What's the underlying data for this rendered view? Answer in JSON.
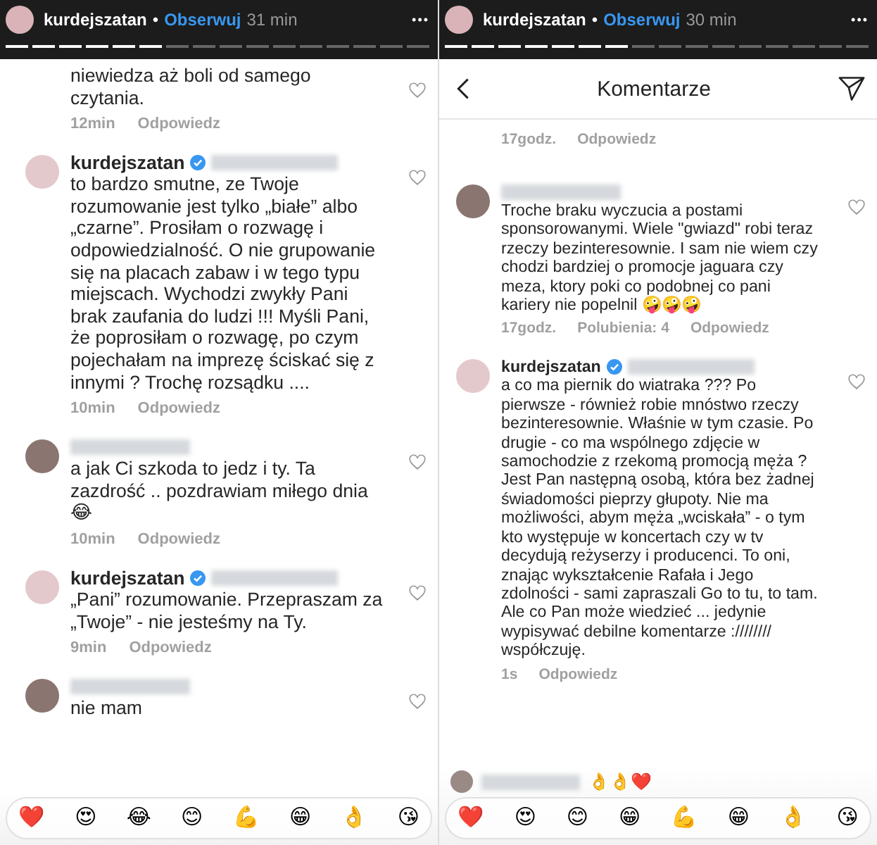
{
  "panels": [
    {
      "story": {
        "username": "kurdejszatan",
        "separator": "•",
        "follow": "Obserwuj",
        "time": "31 min",
        "more": "•••"
      },
      "progress": [
        {
          "seen": true
        },
        {
          "seen": true
        },
        {
          "seen": true
        },
        {
          "seen": true
        },
        {
          "seen": true
        },
        {
          "seen": true
        },
        {
          "seen": false
        },
        {
          "seen": false
        },
        {
          "seen": false
        },
        {
          "seen": false
        },
        {
          "seen": false
        },
        {
          "seen": false
        },
        {
          "seen": false
        },
        {
          "seen": false
        },
        {
          "seen": false
        },
        {
          "seen": false
        }
      ],
      "comments": [
        {
          "kind": "fragment",
          "text": "niewiedza aż boli od samego czytania.",
          "time": "12min",
          "reply": "Odpowiedz"
        },
        {
          "kind": "full",
          "author": {
            "name": "kurdejszatan",
            "verified": true
          },
          "blurred_tag": true,
          "text": "to bardzo smutne, ze Twoje rozumowanie jest tylko „białe” albo „czarne”. Prosiłam o rozwagę i odpowiedzialność. O nie grupowanie się na placach zabaw i w tego typu miejscach. Wychodzi zwykły Pani brak zaufania do ludzi !!! Myśli Pani, że poprosiłam o rozwagę, po czym pojechałam na imprezę ściskać się z innymi ? Trochę rozsądku ....",
          "time": "10min",
          "reply": "Odpowiedz"
        },
        {
          "kind": "full",
          "blurred_tag": true,
          "text": "a jak Ci szkoda to jedz i ty. Ta zazdrość .. pozdrawiam miłego dnia 😂",
          "time": "10min",
          "reply": "Odpowiedz"
        },
        {
          "kind": "full",
          "author": {
            "name": "kurdejszatan",
            "verified": true
          },
          "blurred_tag": true,
          "text": "„Pani” rozumowanie. Przepraszam za „Twoje” - nie jesteśmy na Ty.",
          "time": "9min",
          "reply": "Odpowiedz"
        },
        {
          "kind": "full",
          "blurred_tag": true,
          "text": "nie mam"
        }
      ],
      "composer": {
        "emojis": [
          "❤️",
          "😍",
          "😂",
          "😊",
          "💪",
          "😁",
          "👌",
          "😘"
        ]
      }
    },
    {
      "story": {
        "username": "kurdejszatan",
        "separator": "•",
        "follow": "Obserwuj",
        "time": "30 min",
        "more": "•••"
      },
      "progress": [
        {
          "seen": true
        },
        {
          "seen": true
        },
        {
          "seen": true
        },
        {
          "seen": true
        },
        {
          "seen": true
        },
        {
          "seen": true
        },
        {
          "seen": true
        },
        {
          "seen": false
        },
        {
          "seen": false
        },
        {
          "seen": false
        },
        {
          "seen": false
        },
        {
          "seen": false
        },
        {
          "seen": false
        },
        {
          "seen": false
        },
        {
          "seen": false
        },
        {
          "seen": false
        }
      ],
      "header": {
        "title": "Komentarze"
      },
      "comments": [
        {
          "kind": "fragment",
          "time": "17godz.",
          "reply": "Odpowiedz"
        },
        {
          "kind": "full",
          "blurred_tag": true,
          "text": "Troche braku wyczucia a postami sponsorowanymi. Wiele \"gwiazd\" robi teraz rzeczy bezinteresownie. I sam nie wiem czy chodzi bardziej o promocje jaguara czy meza, ktory poki co podobnej co pani kariery nie popelnil 🤪🤪🤪",
          "time": "17godz.",
          "likes": "Polubienia: 4",
          "reply": "Odpowiedz"
        },
        {
          "kind": "full",
          "author": {
            "name": "kurdejszatan",
            "verified": true
          },
          "blurred_tag": true,
          "text": "a co ma piernik do wiatraka ??? Po pierwsze - również robie mnóstwo rzeczy bezinteresownie. Właśnie w tym czasie. Po drugie - co ma wspólnego zdjęcie w samochodzie z rzekomą promocją męża ? Jest Pan następną osobą, która bez żadnej świadomości pieprzy głupoty. Nie ma możliwości, abym męża „wciskała” - o tym kto występuje w koncertach czy w tv decydują reżyserzy i producenci. To oni, znając wykształcenie Rafała i Jego zdolności - sami zapraszali Go to tu, to tam. Ale co Pan może wiedzieć ... jedynie wypisywać debilne komentarze ://////// współczuję.",
          "time": "1s",
          "reply": "Odpowiedz"
        }
      ],
      "reply_bubble": {
        "text": "👌👌❤️"
      },
      "composer": {
        "emojis": [
          "❤️",
          "😍",
          "😊",
          "😁",
          "💪",
          "😁",
          "👌",
          "😘"
        ]
      }
    }
  ]
}
